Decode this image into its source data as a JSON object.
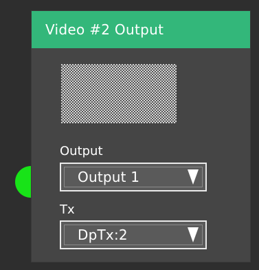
{
  "node": {
    "title": "Video #2 Output",
    "header_color": "#33b77a",
    "preview_icon": "checkerboard-preview"
  },
  "fields": {
    "output": {
      "label": "Output",
      "value": "Output 1",
      "icon": "dropdown-arrow-icon"
    },
    "tx": {
      "label": "Tx",
      "value": "DpTx:2",
      "icon": "dropdown-arrow-icon"
    }
  },
  "port": {
    "color": "#18e318",
    "status": "connected"
  }
}
